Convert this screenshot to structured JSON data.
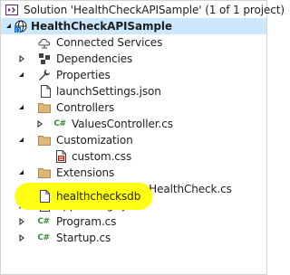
{
  "tree": {
    "solution_label": "Solution 'HealthCheckAPISample' (1 of 1 project)",
    "project_label": "HealthCheckAPISample",
    "items": [
      {
        "label": "Connected Services",
        "icon": "connected-services-icon"
      },
      {
        "label": "Dependencies",
        "icon": "dependencies-icon"
      },
      {
        "label": "Properties",
        "icon": "wrench-icon"
      },
      {
        "label": "launchSettings.json",
        "icon": "json-file-icon"
      },
      {
        "label": "Controllers",
        "icon": "folder-icon"
      },
      {
        "label": "ValuesController.cs",
        "icon": "csharp-file-icon"
      },
      {
        "label": "Customization",
        "icon": "folder-icon"
      },
      {
        "label": "custom.css",
        "icon": "css-file-icon"
      },
      {
        "label": "Extensions",
        "icon": "folder-icon"
      },
      {
        "label": "SqlConnectionHealthCheck.cs",
        "icon": "csharp-file-icon"
      },
      {
        "label": "appsettings.json",
        "icon": "json-file-icon"
      },
      {
        "label": "healthchecksdb",
        "icon": "file-icon"
      },
      {
        "label": "Program.cs",
        "icon": "csharp-file-icon"
      },
      {
        "label": "Startup.cs",
        "icon": "csharp-file-icon"
      }
    ],
    "csharp_badge": "C#"
  },
  "colors": {
    "selection": "#cce8ff",
    "highlight": "#ffff14",
    "folder": "#dcb67a",
    "csharp": "#388a34"
  }
}
